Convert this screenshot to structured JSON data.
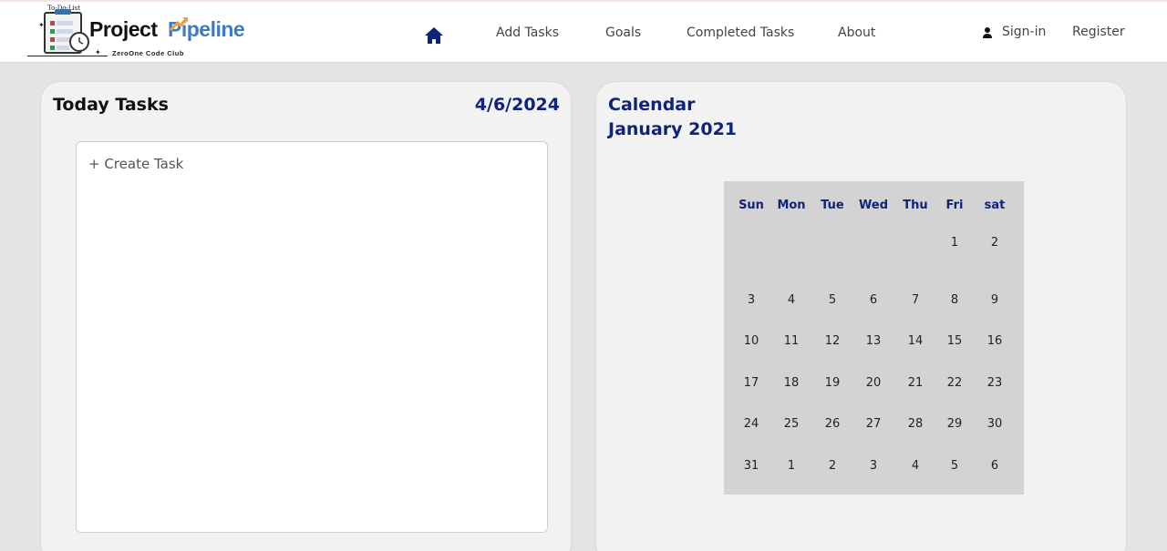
{
  "header": {
    "logo": {
      "caption": "To-Do-List",
      "word1": "Project",
      "word2": "Pipeline",
      "club": "ZeroOne Code Club"
    },
    "nav": {
      "home_icon": "home-icon",
      "items": [
        "Add Tasks",
        "Goals",
        "Completed Tasks",
        "About"
      ]
    },
    "auth": {
      "user_icon": "user-icon",
      "signin": "Sign-in",
      "register": "Register"
    }
  },
  "today": {
    "title": "Today Tasks",
    "date": "4/6/2024",
    "create_task": "+ Create Task"
  },
  "calendar": {
    "title": "Calendar",
    "month": "January 2021",
    "weekdays": [
      "Sun",
      "Mon",
      "Tue",
      "Wed",
      "Thu",
      "Fri",
      "sat"
    ],
    "weeks": [
      [
        "",
        "",
        "",
        "",
        "",
        "1",
        "2"
      ],
      [
        "3",
        "4",
        "5",
        "6",
        "7",
        "8",
        "9"
      ],
      [
        "10",
        "11",
        "12",
        "13",
        "14",
        "15",
        "16"
      ],
      [
        "17",
        "18",
        "19",
        "20",
        "21",
        "22",
        "23"
      ],
      [
        "24",
        "25",
        "26",
        "27",
        "28",
        "29",
        "30"
      ],
      [
        "31",
        "1",
        "2",
        "3",
        "4",
        "5",
        "6"
      ]
    ]
  },
  "colors": {
    "accent_navy": "#10237a",
    "logo_blue": "#3d7cc4",
    "logo_orange": "#e8a23a",
    "calendar_bg": "#d3d3d3"
  }
}
